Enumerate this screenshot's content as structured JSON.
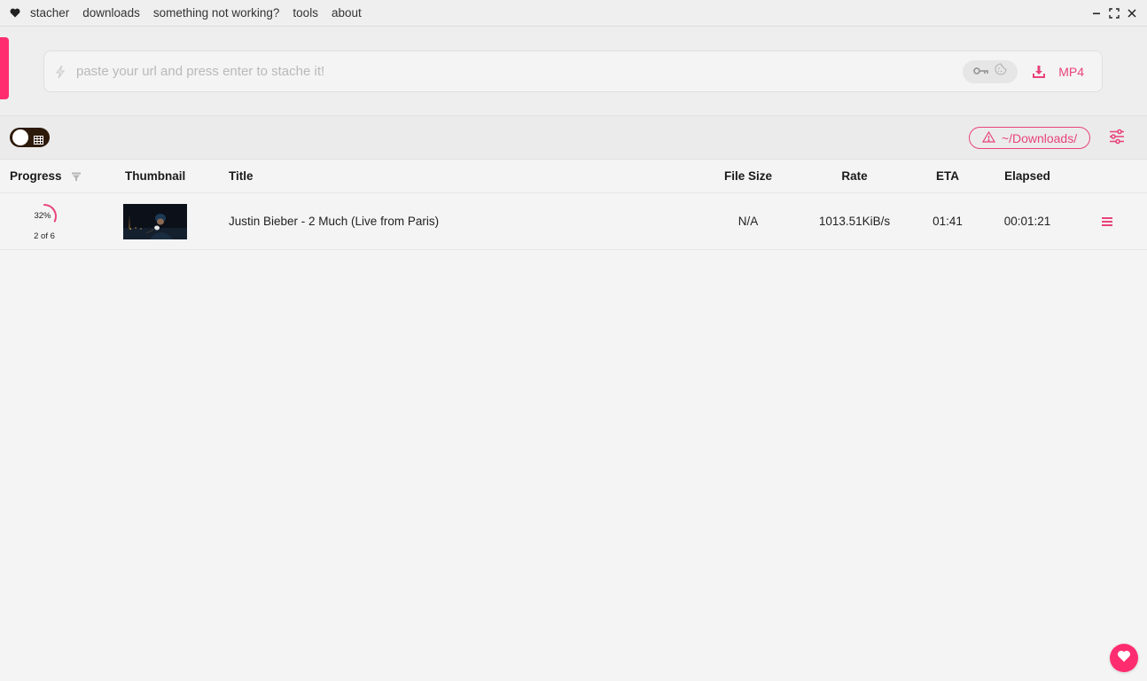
{
  "titlebar": {
    "logo_icon": "heart-icon",
    "menu": [
      "stacher",
      "downloads",
      "something not working?",
      "tools",
      "about"
    ],
    "controls": [
      "minimize-icon",
      "maximize-icon",
      "close-icon"
    ]
  },
  "url_bar": {
    "placeholder": "paste your url and press enter to stache it!",
    "value": "",
    "left_icon": "lightning-icon",
    "auth_icons": [
      "key-icon",
      "cookie-icon"
    ],
    "download_icon": "download-icon",
    "format": "MP4"
  },
  "toolbar": {
    "view_toggle_icon": "grid-icon",
    "download_path": "~/Downloads/",
    "path_icon": "warning-icon",
    "settings_icon": "sliders-icon"
  },
  "table": {
    "columns": [
      "Progress",
      "Thumbnail",
      "Title",
      "File Size",
      "Rate",
      "ETA",
      "Elapsed"
    ],
    "rows": [
      {
        "progress_percent": 32,
        "progress_label": "32%",
        "part": "2 of 6",
        "title": "Justin Bieber - 2 Much (Live from Paris)",
        "file_size": "N/A",
        "rate": "1013.51KiB/s",
        "eta": "01:41",
        "elapsed": "00:01:21"
      }
    ]
  },
  "colors": {
    "accent": "#ff2d6f",
    "accent_text": "#e8437a",
    "toggle_bg": "#2d1a0a"
  },
  "support_button_icon": "heart-icon"
}
